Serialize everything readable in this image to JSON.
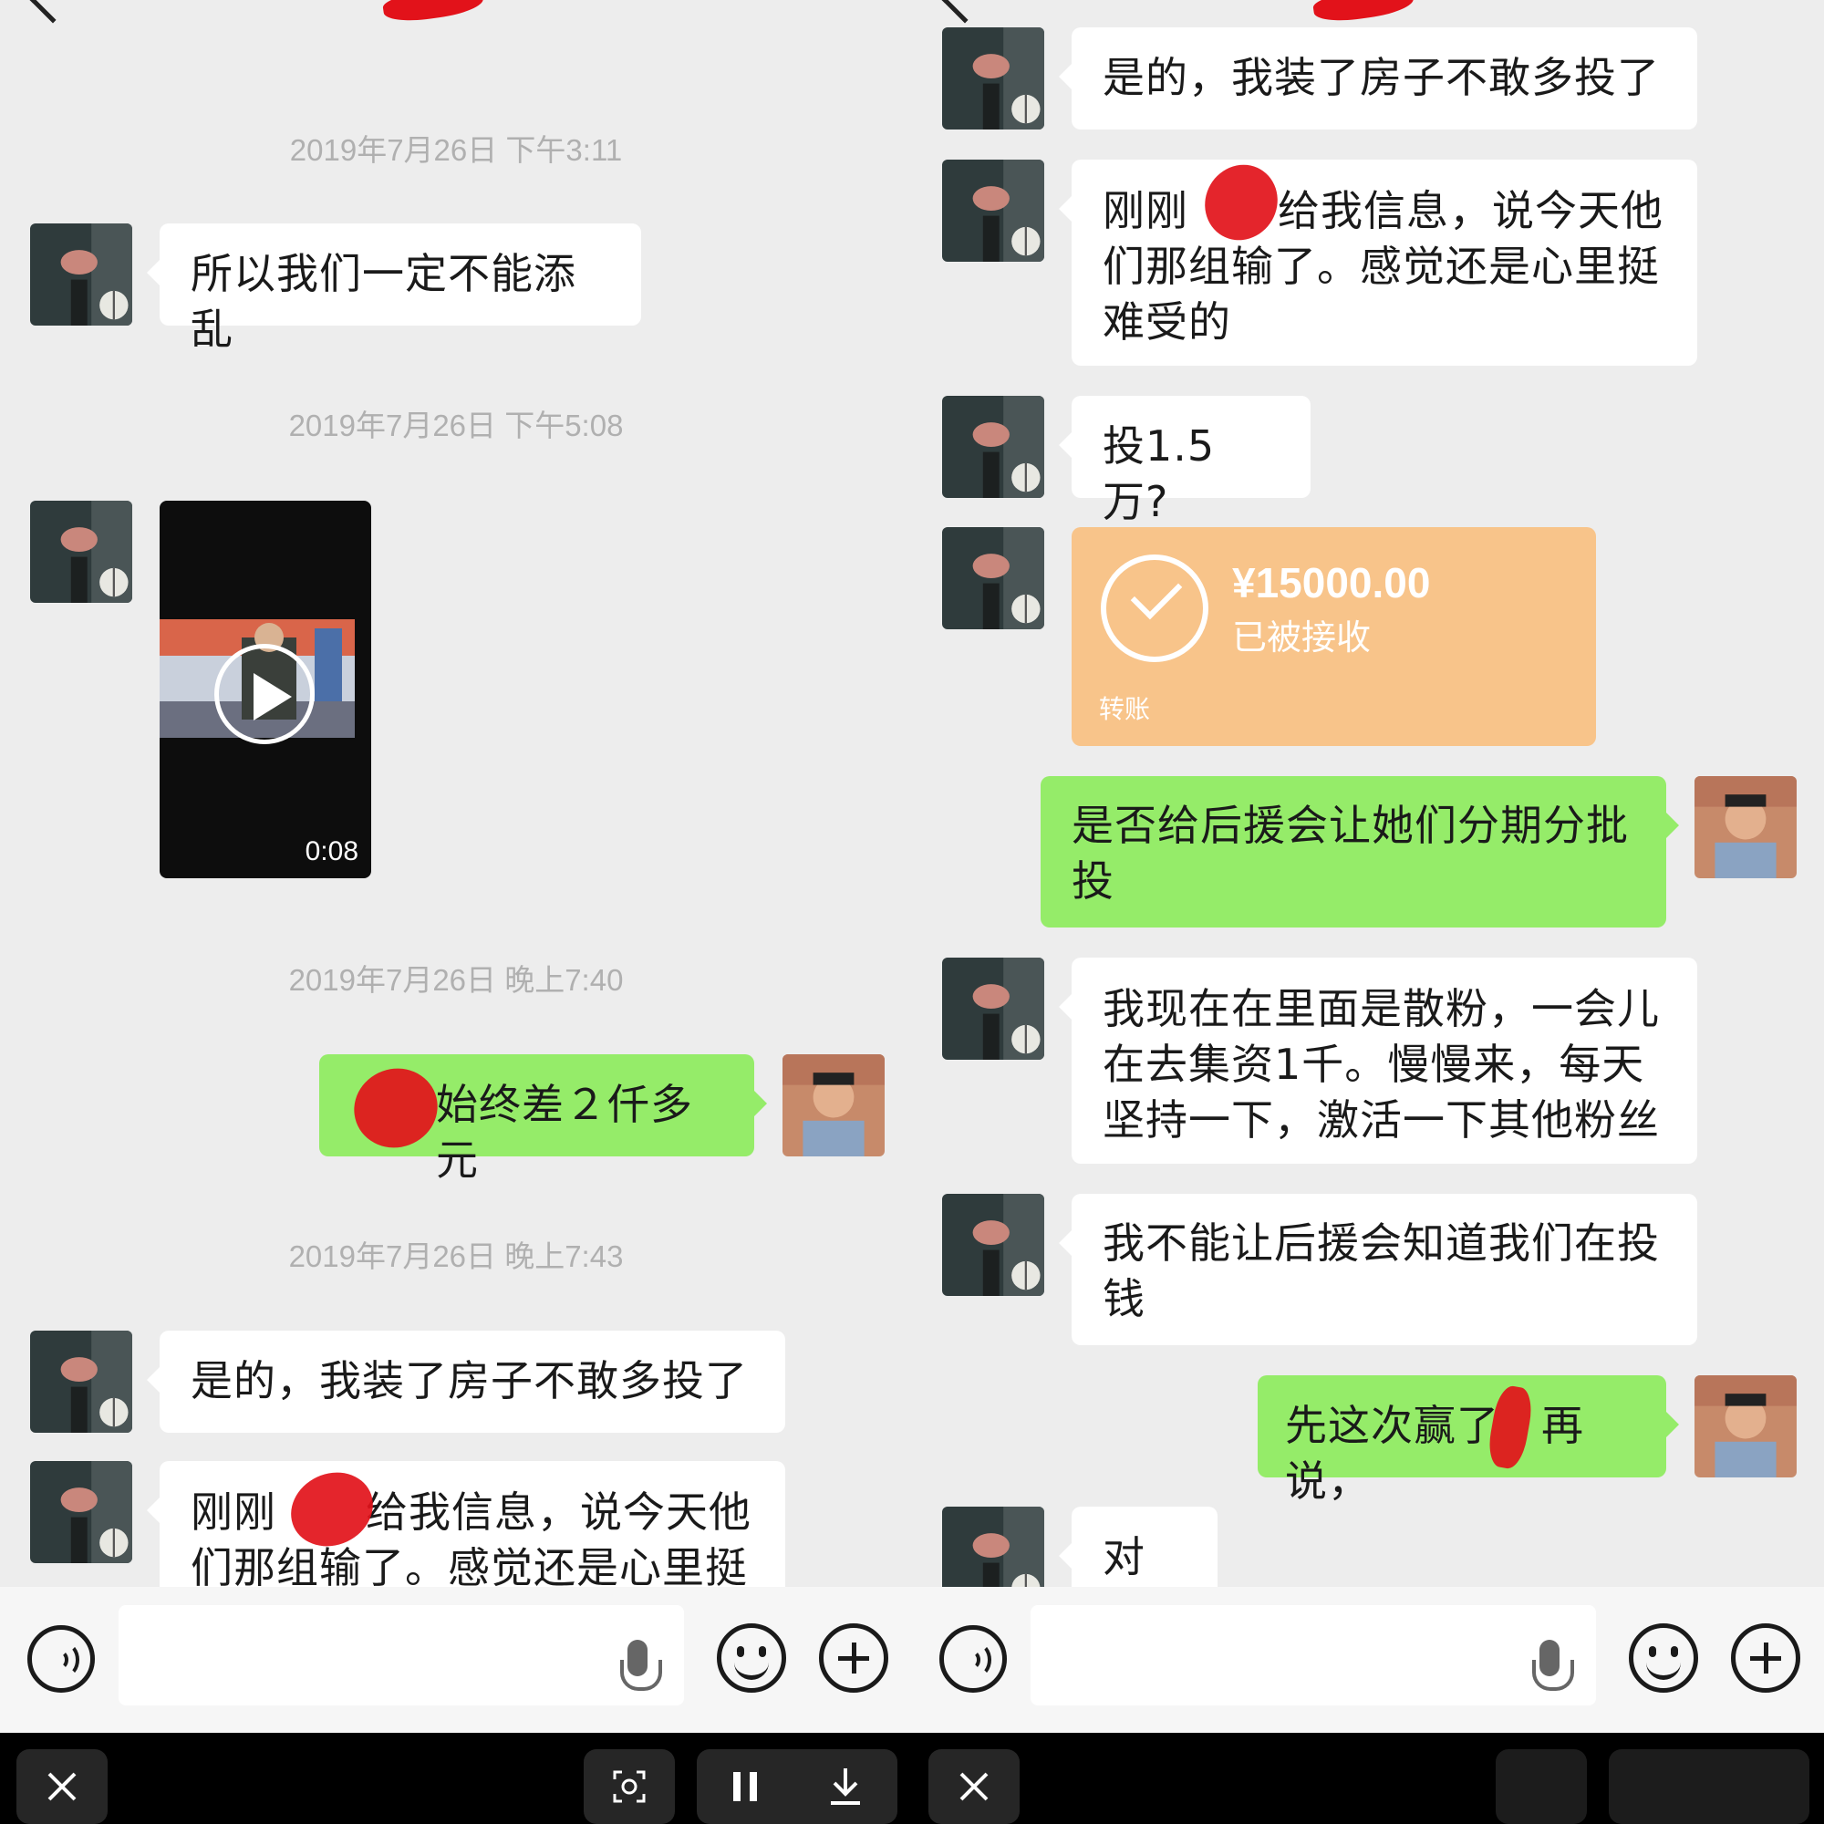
{
  "left_panel": {
    "timestamps": [
      "2019年7月26日 下午3:11",
      "2019年7月26日 下午5:08",
      "2019年7月26日 晚上7:40",
      "2019年7月26日 晚上7:43"
    ],
    "messages": {
      "m1": "所以我们一定不能添乱",
      "video_duration": "0:08",
      "m3": "始终差２仟多元",
      "m4": "是的，我装了房子不敢多投了",
      "m5_line1": "刚刚",
      "m5_line1b": "给我信息，说今天他",
      "m5_line2": "们那组输了。感觉还是心里挺"
    }
  },
  "right_panel": {
    "messages": {
      "r1": "是的，我装了房子不敢多投了",
      "r2_line1a": "刚刚",
      "r2_line1b": "给我信息，说今天他",
      "r2_rest": "们那组输了。感觉还是心里挺难受的",
      "r3": "投1.5万?",
      "r5": "是否给后援会让她们分期分批投",
      "r6": "我现在在里面是散粉，一会儿在去集资1千。慢慢来，每天坚持一下，激活一下其他粉丝",
      "r7": "我不能让后援会知道我们在投钱",
      "r8a": "先这次赢了",
      "r8b": "再说，",
      "r9": "对呀"
    },
    "transfer": {
      "amount": "¥15000.00",
      "status": "已被接收",
      "label": "转账"
    }
  },
  "icons": {
    "back": "back-arrow-icon",
    "voice": "voice-icon",
    "mic": "microphone-icon",
    "emoji": "emoji-icon",
    "plus": "plus-icon",
    "close": "close-icon",
    "scan": "scan-icon",
    "pause": "pause-icon",
    "download": "download-icon"
  },
  "colors": {
    "chat_background": "#ededed",
    "incoming_bubble": "#ffffff",
    "outgoing_bubble": "#95ec69",
    "transfer_card": "#f8c48a",
    "redaction": "#e2121a"
  }
}
